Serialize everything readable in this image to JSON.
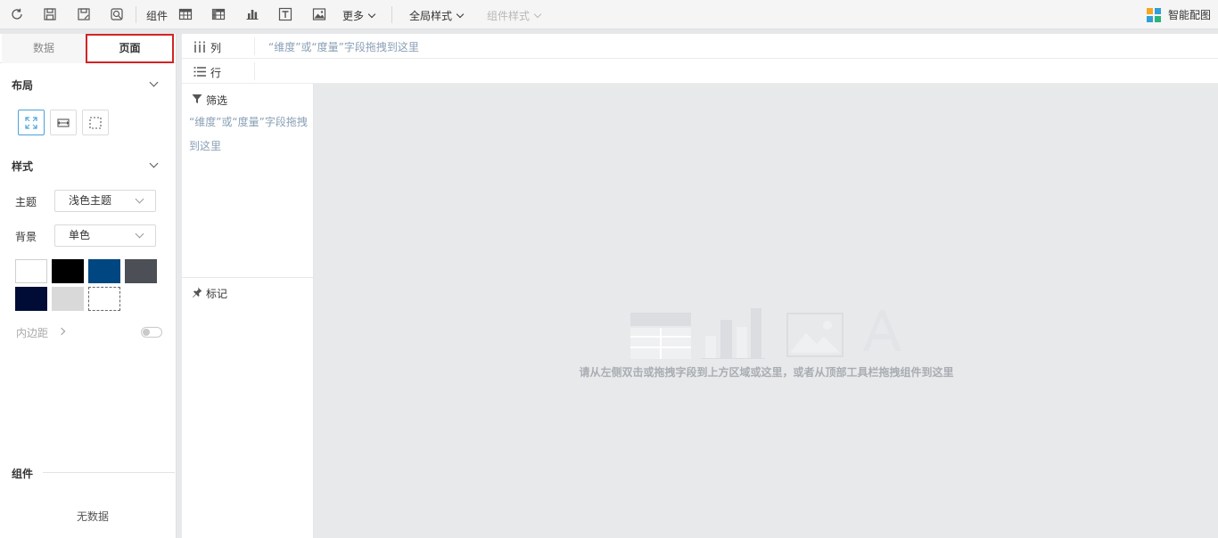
{
  "toolbar": {
    "icons": [
      "refresh-icon",
      "save-icon",
      "save-as-icon",
      "preview-icon"
    ],
    "component_label": "组件",
    "more_label": "更多",
    "global_style_label": "全局样式",
    "component_style_label": "组件样式",
    "smart_label": "智能配图"
  },
  "left_panel": {
    "tabs": [
      {
        "label": "数据",
        "active": false
      },
      {
        "label": "页面",
        "active": true
      }
    ],
    "layout_title": "布局",
    "style_title": "样式",
    "theme_label": "主题",
    "theme_value": "浅色主题",
    "background_label": "背景",
    "background_value": "单色",
    "swatches": [
      "#ffffff",
      "#000000",
      "#004680",
      "#4d4f56",
      "#000c35",
      "#d9d9d9",
      "transparent"
    ],
    "inner_padding_label": "内边距",
    "components_title": "组件",
    "no_data": "无数据"
  },
  "shelves": {
    "columns_label": "列",
    "rows_label": "行",
    "columns_hint": "“维度”或“度量”字段拖拽到这里"
  },
  "filter_panel": {
    "filter_title": "筛选",
    "filter_hint": "“维度”或“度量”字段拖拽到这里",
    "marks_title": "标记"
  },
  "canvas": {
    "hint": "请从左侧双击或拖拽字段到上方区域或这里，或者从顶部工具栏拖拽组件到这里"
  },
  "colors": {
    "accent": "#4aa3d9",
    "active_tab_border": "#d32424",
    "hint_blue": "#8aa0b6"
  }
}
